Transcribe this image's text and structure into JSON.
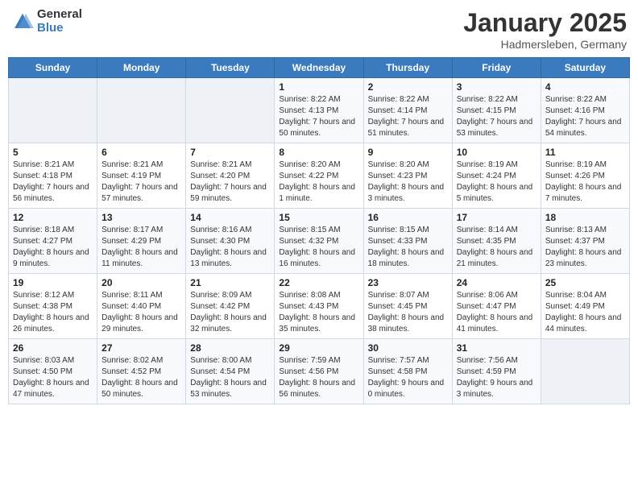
{
  "header": {
    "logo_general": "General",
    "logo_blue": "Blue",
    "title": "January 2025",
    "subtitle": "Hadmersleben, Germany"
  },
  "days_of_week": [
    "Sunday",
    "Monday",
    "Tuesday",
    "Wednesday",
    "Thursday",
    "Friday",
    "Saturday"
  ],
  "weeks": [
    [
      {
        "day": null
      },
      {
        "day": null
      },
      {
        "day": null
      },
      {
        "day": "1",
        "sunrise": "Sunrise: 8:22 AM",
        "sunset": "Sunset: 4:13 PM",
        "daylight": "Daylight: 7 hours and 50 minutes."
      },
      {
        "day": "2",
        "sunrise": "Sunrise: 8:22 AM",
        "sunset": "Sunset: 4:14 PM",
        "daylight": "Daylight: 7 hours and 51 minutes."
      },
      {
        "day": "3",
        "sunrise": "Sunrise: 8:22 AM",
        "sunset": "Sunset: 4:15 PM",
        "daylight": "Daylight: 7 hours and 53 minutes."
      },
      {
        "day": "4",
        "sunrise": "Sunrise: 8:22 AM",
        "sunset": "Sunset: 4:16 PM",
        "daylight": "Daylight: 7 hours and 54 minutes."
      }
    ],
    [
      {
        "day": "5",
        "sunrise": "Sunrise: 8:21 AM",
        "sunset": "Sunset: 4:18 PM",
        "daylight": "Daylight: 7 hours and 56 minutes."
      },
      {
        "day": "6",
        "sunrise": "Sunrise: 8:21 AM",
        "sunset": "Sunset: 4:19 PM",
        "daylight": "Daylight: 7 hours and 57 minutes."
      },
      {
        "day": "7",
        "sunrise": "Sunrise: 8:21 AM",
        "sunset": "Sunset: 4:20 PM",
        "daylight": "Daylight: 7 hours and 59 minutes."
      },
      {
        "day": "8",
        "sunrise": "Sunrise: 8:20 AM",
        "sunset": "Sunset: 4:22 PM",
        "daylight": "Daylight: 8 hours and 1 minute."
      },
      {
        "day": "9",
        "sunrise": "Sunrise: 8:20 AM",
        "sunset": "Sunset: 4:23 PM",
        "daylight": "Daylight: 8 hours and 3 minutes."
      },
      {
        "day": "10",
        "sunrise": "Sunrise: 8:19 AM",
        "sunset": "Sunset: 4:24 PM",
        "daylight": "Daylight: 8 hours and 5 minutes."
      },
      {
        "day": "11",
        "sunrise": "Sunrise: 8:19 AM",
        "sunset": "Sunset: 4:26 PM",
        "daylight": "Daylight: 8 hours and 7 minutes."
      }
    ],
    [
      {
        "day": "12",
        "sunrise": "Sunrise: 8:18 AM",
        "sunset": "Sunset: 4:27 PM",
        "daylight": "Daylight: 8 hours and 9 minutes."
      },
      {
        "day": "13",
        "sunrise": "Sunrise: 8:17 AM",
        "sunset": "Sunset: 4:29 PM",
        "daylight": "Daylight: 8 hours and 11 minutes."
      },
      {
        "day": "14",
        "sunrise": "Sunrise: 8:16 AM",
        "sunset": "Sunset: 4:30 PM",
        "daylight": "Daylight: 8 hours and 13 minutes."
      },
      {
        "day": "15",
        "sunrise": "Sunrise: 8:15 AM",
        "sunset": "Sunset: 4:32 PM",
        "daylight": "Daylight: 8 hours and 16 minutes."
      },
      {
        "day": "16",
        "sunrise": "Sunrise: 8:15 AM",
        "sunset": "Sunset: 4:33 PM",
        "daylight": "Daylight: 8 hours and 18 minutes."
      },
      {
        "day": "17",
        "sunrise": "Sunrise: 8:14 AM",
        "sunset": "Sunset: 4:35 PM",
        "daylight": "Daylight: 8 hours and 21 minutes."
      },
      {
        "day": "18",
        "sunrise": "Sunrise: 8:13 AM",
        "sunset": "Sunset: 4:37 PM",
        "daylight": "Daylight: 8 hours and 23 minutes."
      }
    ],
    [
      {
        "day": "19",
        "sunrise": "Sunrise: 8:12 AM",
        "sunset": "Sunset: 4:38 PM",
        "daylight": "Daylight: 8 hours and 26 minutes."
      },
      {
        "day": "20",
        "sunrise": "Sunrise: 8:11 AM",
        "sunset": "Sunset: 4:40 PM",
        "daylight": "Daylight: 8 hours and 29 minutes."
      },
      {
        "day": "21",
        "sunrise": "Sunrise: 8:09 AM",
        "sunset": "Sunset: 4:42 PM",
        "daylight": "Daylight: 8 hours and 32 minutes."
      },
      {
        "day": "22",
        "sunrise": "Sunrise: 8:08 AM",
        "sunset": "Sunset: 4:43 PM",
        "daylight": "Daylight: 8 hours and 35 minutes."
      },
      {
        "day": "23",
        "sunrise": "Sunrise: 8:07 AM",
        "sunset": "Sunset: 4:45 PM",
        "daylight": "Daylight: 8 hours and 38 minutes."
      },
      {
        "day": "24",
        "sunrise": "Sunrise: 8:06 AM",
        "sunset": "Sunset: 4:47 PM",
        "daylight": "Daylight: 8 hours and 41 minutes."
      },
      {
        "day": "25",
        "sunrise": "Sunrise: 8:04 AM",
        "sunset": "Sunset: 4:49 PM",
        "daylight": "Daylight: 8 hours and 44 minutes."
      }
    ],
    [
      {
        "day": "26",
        "sunrise": "Sunrise: 8:03 AM",
        "sunset": "Sunset: 4:50 PM",
        "daylight": "Daylight: 8 hours and 47 minutes."
      },
      {
        "day": "27",
        "sunrise": "Sunrise: 8:02 AM",
        "sunset": "Sunset: 4:52 PM",
        "daylight": "Daylight: 8 hours and 50 minutes."
      },
      {
        "day": "28",
        "sunrise": "Sunrise: 8:00 AM",
        "sunset": "Sunset: 4:54 PM",
        "daylight": "Daylight: 8 hours and 53 minutes."
      },
      {
        "day": "29",
        "sunrise": "Sunrise: 7:59 AM",
        "sunset": "Sunset: 4:56 PM",
        "daylight": "Daylight: 8 hours and 56 minutes."
      },
      {
        "day": "30",
        "sunrise": "Sunrise: 7:57 AM",
        "sunset": "Sunset: 4:58 PM",
        "daylight": "Daylight: 9 hours and 0 minutes."
      },
      {
        "day": "31",
        "sunrise": "Sunrise: 7:56 AM",
        "sunset": "Sunset: 4:59 PM",
        "daylight": "Daylight: 9 hours and 3 minutes."
      },
      {
        "day": null
      }
    ]
  ]
}
